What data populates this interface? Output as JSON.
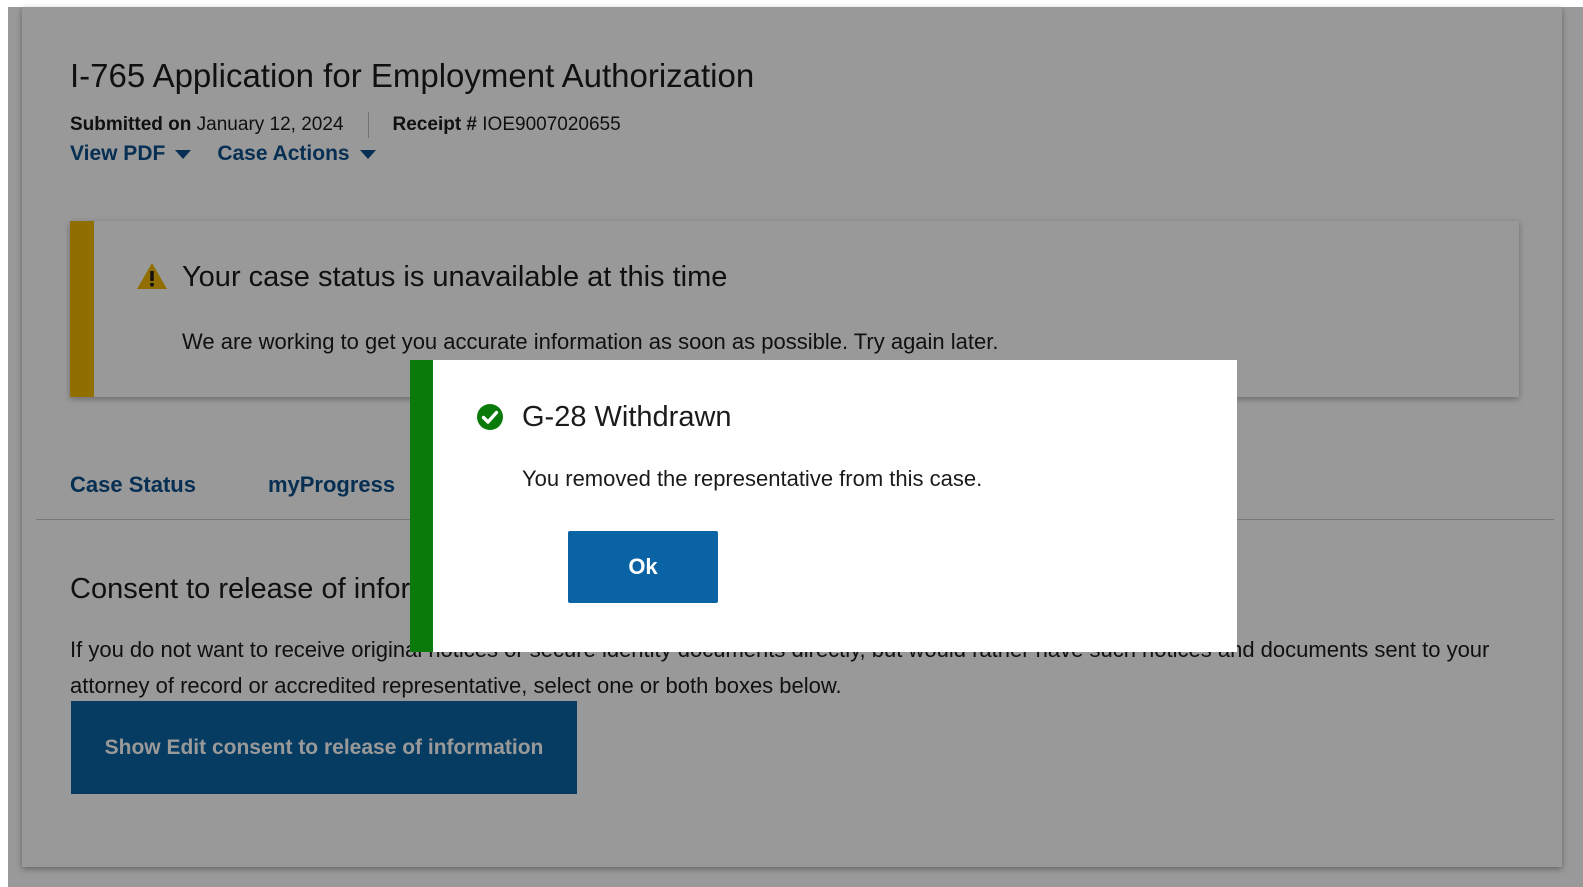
{
  "header": {
    "title": "I-765 Application for Employment Authorization",
    "submitted_label": "Submitted on",
    "submitted_date": "January 12, 2024",
    "receipt_label": "Receipt #",
    "receipt_number": "IOE9007020655"
  },
  "actions": {
    "view_pdf": "View PDF",
    "case_actions": "Case Actions"
  },
  "alert": {
    "title": "Your case status is unavailable at this time",
    "body": "We are working to get you accurate information as soon as possible. Try again later.",
    "accent_color": "#f2b800"
  },
  "tabs": {
    "case_status": "Case Status",
    "my_progress": "myProgress"
  },
  "consent": {
    "title": "Consent to release of information",
    "body": "If you do not want to receive original notices or secure identity documents directly, but would rather have such notices and documents sent to your attorney of record or accredited representative, select one or both boxes below.",
    "button_label": "Show Edit consent to release of information"
  },
  "modal": {
    "title": "G-28 Withdrawn",
    "body": "You removed the representative from this case.",
    "ok_label": "Ok",
    "accent_color": "#0a7a0a",
    "icon": "check-circle-icon"
  }
}
